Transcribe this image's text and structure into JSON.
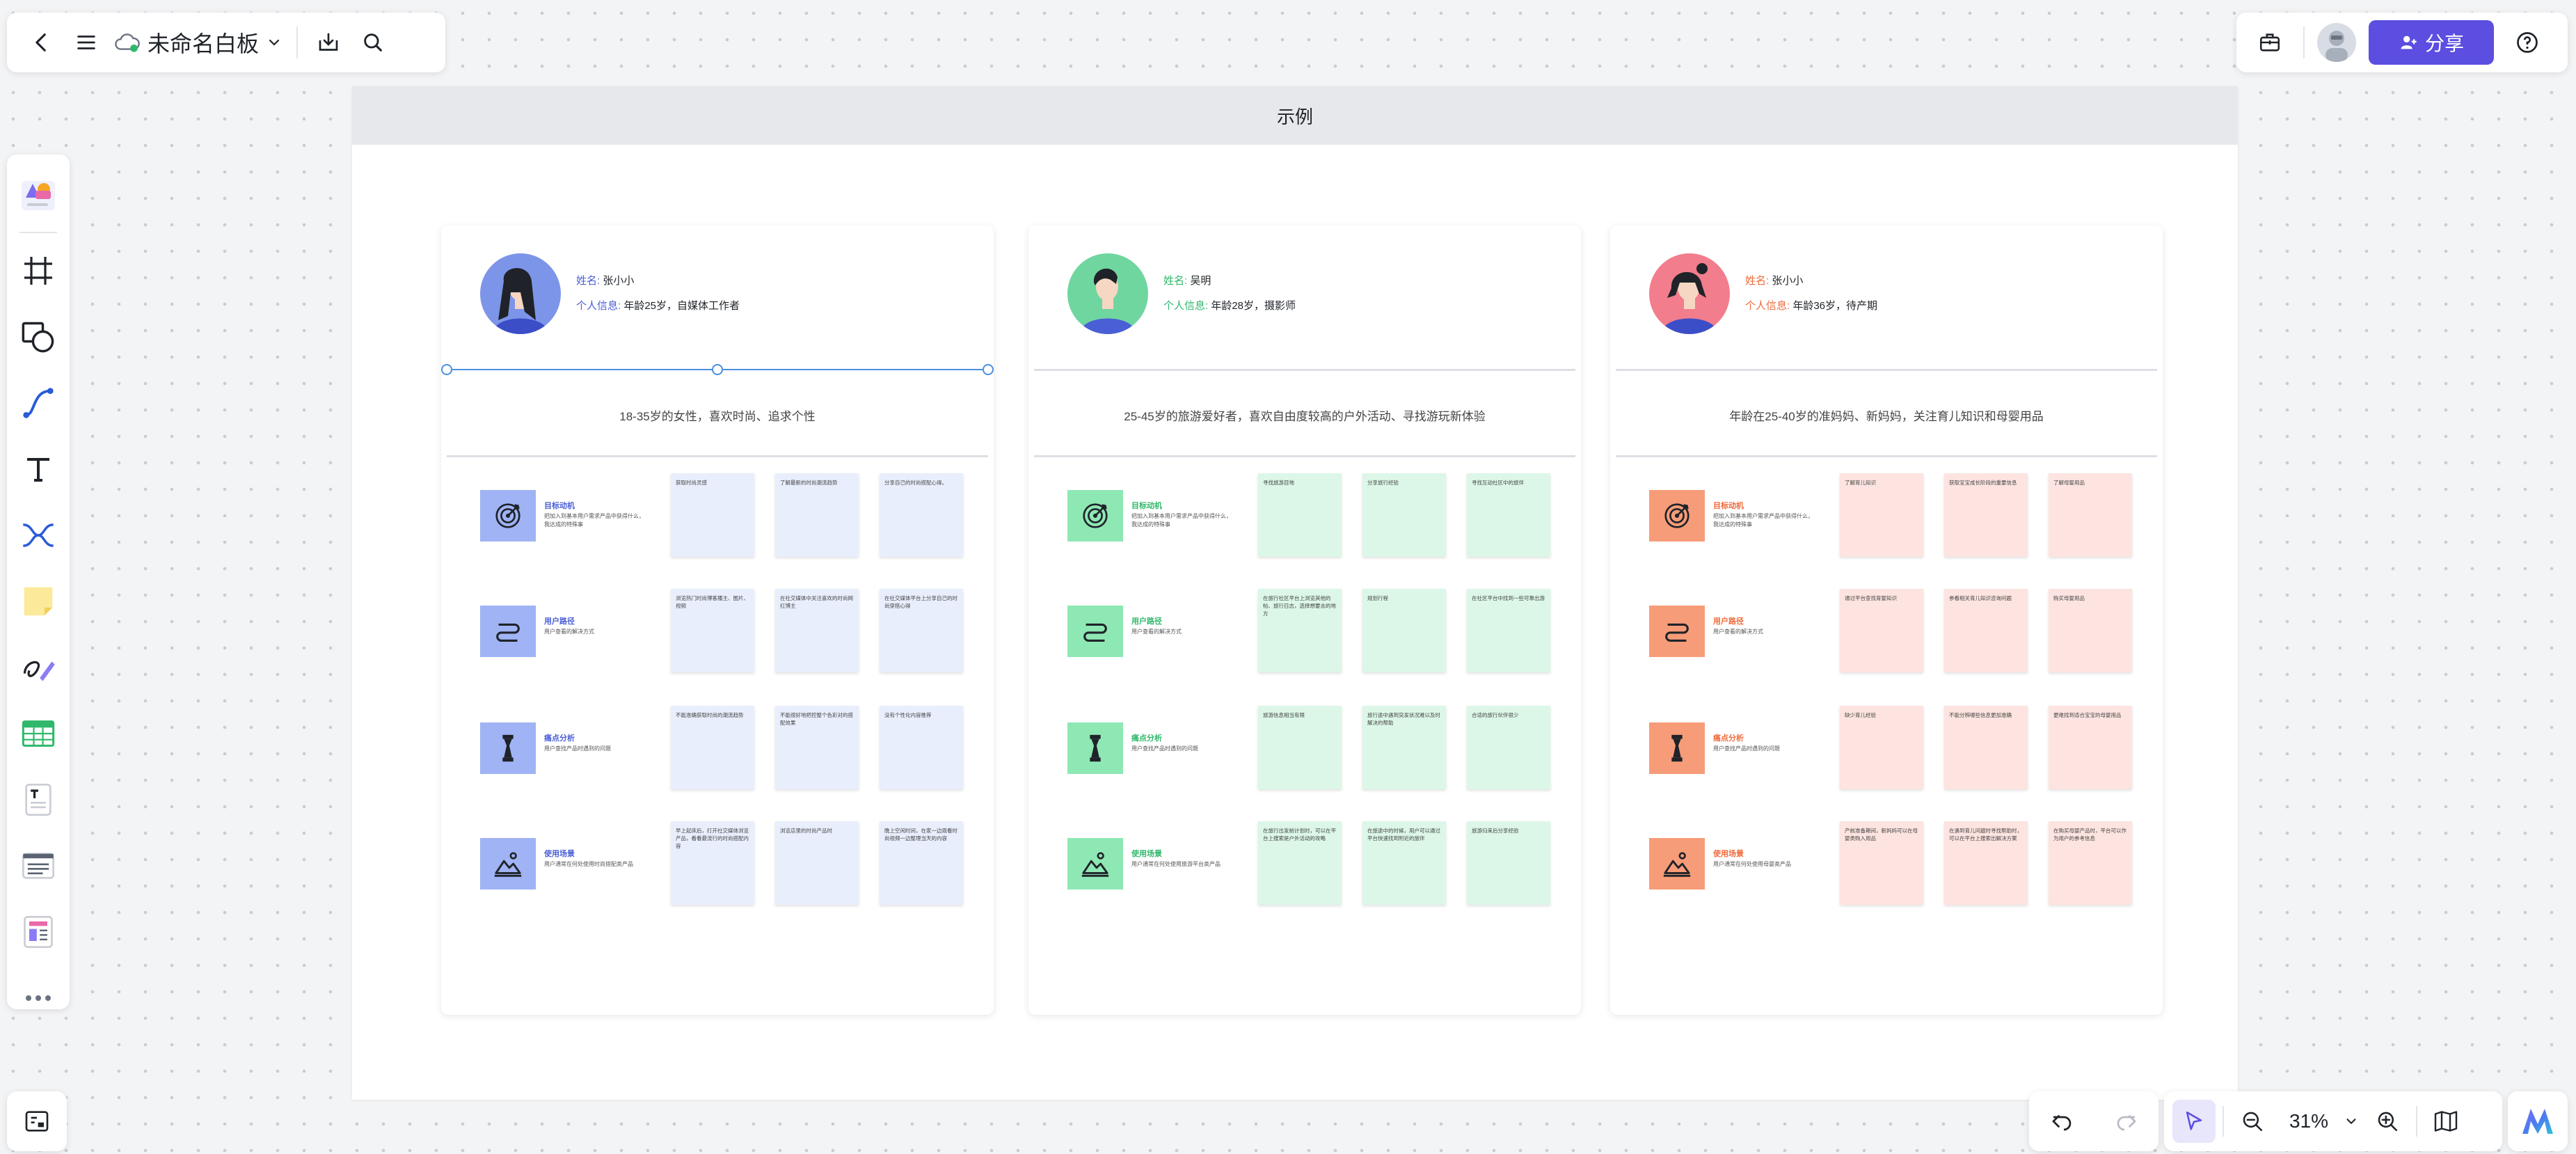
{
  "board": {
    "title": "未命名白板"
  },
  "header": {
    "share_label": "分享"
  },
  "zoom": {
    "level": "31%"
  },
  "frame": {
    "title": "示例"
  },
  "colors": {
    "accent": "#5b4ee0",
    "blue": "#4a5fd6",
    "green": "#2fb86b",
    "orange": "#f06a3a"
  },
  "personas": [
    {
      "name_label": "姓名:",
      "name": "张小小",
      "info_label": "个人信息:",
      "info": "年龄25岁，自媒体工作者",
      "summary": "18-35岁的女性，喜欢时尚、追求个性",
      "sections": [
        {
          "icon": "target-icon",
          "title": "目标动机",
          "desc": "把加入到基本用户需求产品中获得什么，我达成的特殊事",
          "notes": [
            "获取时尚灵感",
            "了解最新的时尚潮流趋势",
            "分享自己的时尚搭配心得。"
          ]
        },
        {
          "icon": "path-icon",
          "title": "用户路径",
          "desc": "用户查看的解决方式",
          "notes": [
            "浏览热门时尚博客播主、图片、视频",
            "在社交媒体中关注喜欢的时尚网红博主",
            "在社交媒体平台上分享自己的时尚穿搭心得"
          ]
        },
        {
          "icon": "pain-icon",
          "title": "痛点分析",
          "desc": "用户查找产品时遇到的问题",
          "notes": [
            "不能准确获取时尚的潮流趋势",
            "不能很好地把控整个色彩对的搭配效果",
            "没有个性化内容推荐"
          ]
        },
        {
          "icon": "scene-icon",
          "title": "使用场景",
          "desc": "用户通常在何处使用时尚搭配类产品",
          "notes": [
            "早上起床后，打开社交媒体浏览产品，看看最流行的时尚搭配内容",
            "浏览店里的时尚产品时",
            "晚上空闲时间，在家一边观看时尚视频一边整理当天的内容"
          ]
        }
      ]
    },
    {
      "name_label": "姓名:",
      "name": "吴明",
      "info_label": "个人信息:",
      "info": "年龄28岁，摄影师",
      "summary": "25-45岁的旅游爱好者，喜欢自由度较高的户外活动、寻找游玩新体验",
      "sections": [
        {
          "icon": "target-icon",
          "title": "目标动机",
          "desc": "把加入到基本用户需求产品中获得什么，我达成的特殊事",
          "notes": [
            "寻找旅游目地",
            "分享旅行经验",
            "寻找互动社区中的旅伴"
          ]
        },
        {
          "icon": "path-icon",
          "title": "用户路径",
          "desc": "用户查看的解决方式",
          "notes": [
            "在旅行社区平台上浏览其他的帖、旅行日志，选择想要去的地方",
            "规划行程",
            "在社区平台中找到一些可靠出游"
          ]
        },
        {
          "icon": "pain-icon",
          "title": "痛点分析",
          "desc": "用户查找产品时遇到的问题",
          "notes": [
            "旅游信息相当有限",
            "旅行途中遇到突发状况难以及时解决的帮助",
            "合适的旅行伙伴很少"
          ]
        },
        {
          "icon": "scene-icon",
          "title": "使用场景",
          "desc": "用户通常在何处使用旅游平台类产品",
          "notes": [
            "在旅行出发前计划时，可以在平台上搜索是户外活动的攻略",
            "在旅途中的时候，用户可以通过平台快速找到附近的旅伴",
            "旅游归来后分享经验"
          ]
        }
      ]
    },
    {
      "name_label": "姓名:",
      "name": "张小小",
      "info_label": "个人信息:",
      "info": "年龄36岁，待产期",
      "summary": "年龄在25-40岁的准妈妈、新妈妈，关注育儿知识和母婴用品",
      "sections": [
        {
          "icon": "target-icon",
          "title": "目标动机",
          "desc": "把加入到基本用户需求产品中获得什么，我达成的特殊事",
          "notes": [
            "了解育儿知识",
            "获取宝宝成长阶段的重要信息",
            "了解母婴用品"
          ]
        },
        {
          "icon": "path-icon",
          "title": "用户路径",
          "desc": "用户查看的解决方式",
          "notes": [
            "通过平台查找育婴知识",
            "参看相关育儿知识咨询问题",
            "购买母婴用品"
          ]
        },
        {
          "icon": "pain-icon",
          "title": "痛点分析",
          "desc": "用户查找产品时遇到的问题",
          "notes": [
            "缺少育儿经验",
            "不能分辨哪些信息更加准确",
            "更难找到适合宝宝的母婴用品"
          ]
        },
        {
          "icon": "scene-icon",
          "title": "使用场景",
          "desc": "用户通常在何处使用母婴类产品",
          "notes": [
            "产前准备期间，新妈妈可以在母婴类购入用品",
            "在遇到育儿问题时寻找帮助时，可以在平台上搜索出解决方案",
            "在购买母婴产品时，平台可以作为用户的参考信息"
          ]
        }
      ]
    }
  ]
}
